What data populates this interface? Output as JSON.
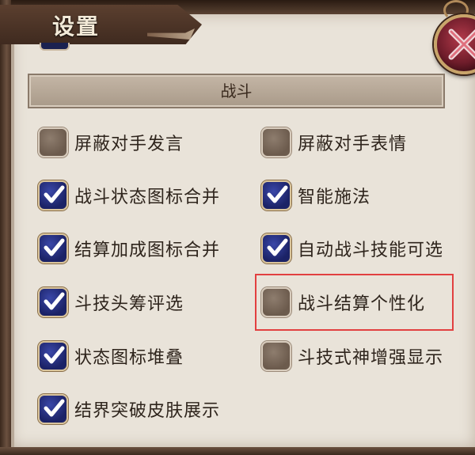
{
  "window": {
    "title": "设置"
  },
  "section": {
    "title": "战斗"
  },
  "options": [
    {
      "label": "屏蔽对手发言",
      "checked": false
    },
    {
      "label": "屏蔽对手表情",
      "checked": false
    },
    {
      "label": "战斗状态图标合并",
      "checked": true
    },
    {
      "label": "智能施法",
      "checked": true
    },
    {
      "label": "结算加成图标合并",
      "checked": true
    },
    {
      "label": "自动战斗技能可选",
      "checked": true
    },
    {
      "label": "斗技头筹评选",
      "checked": true
    },
    {
      "label": "战斗结算个性化",
      "checked": false
    },
    {
      "label": "状态图标堆叠",
      "checked": true
    },
    {
      "label": "斗技式神增强显示",
      "checked": false
    },
    {
      "label": "结界突破皮肤展示",
      "checked": true
    }
  ],
  "icons": {
    "close": "close-icon",
    "check": "checkmark-icon"
  },
  "colors": {
    "highlight": "#e24040",
    "checked_box": "#1b2266",
    "unchecked_box": "#6c5b4d"
  }
}
